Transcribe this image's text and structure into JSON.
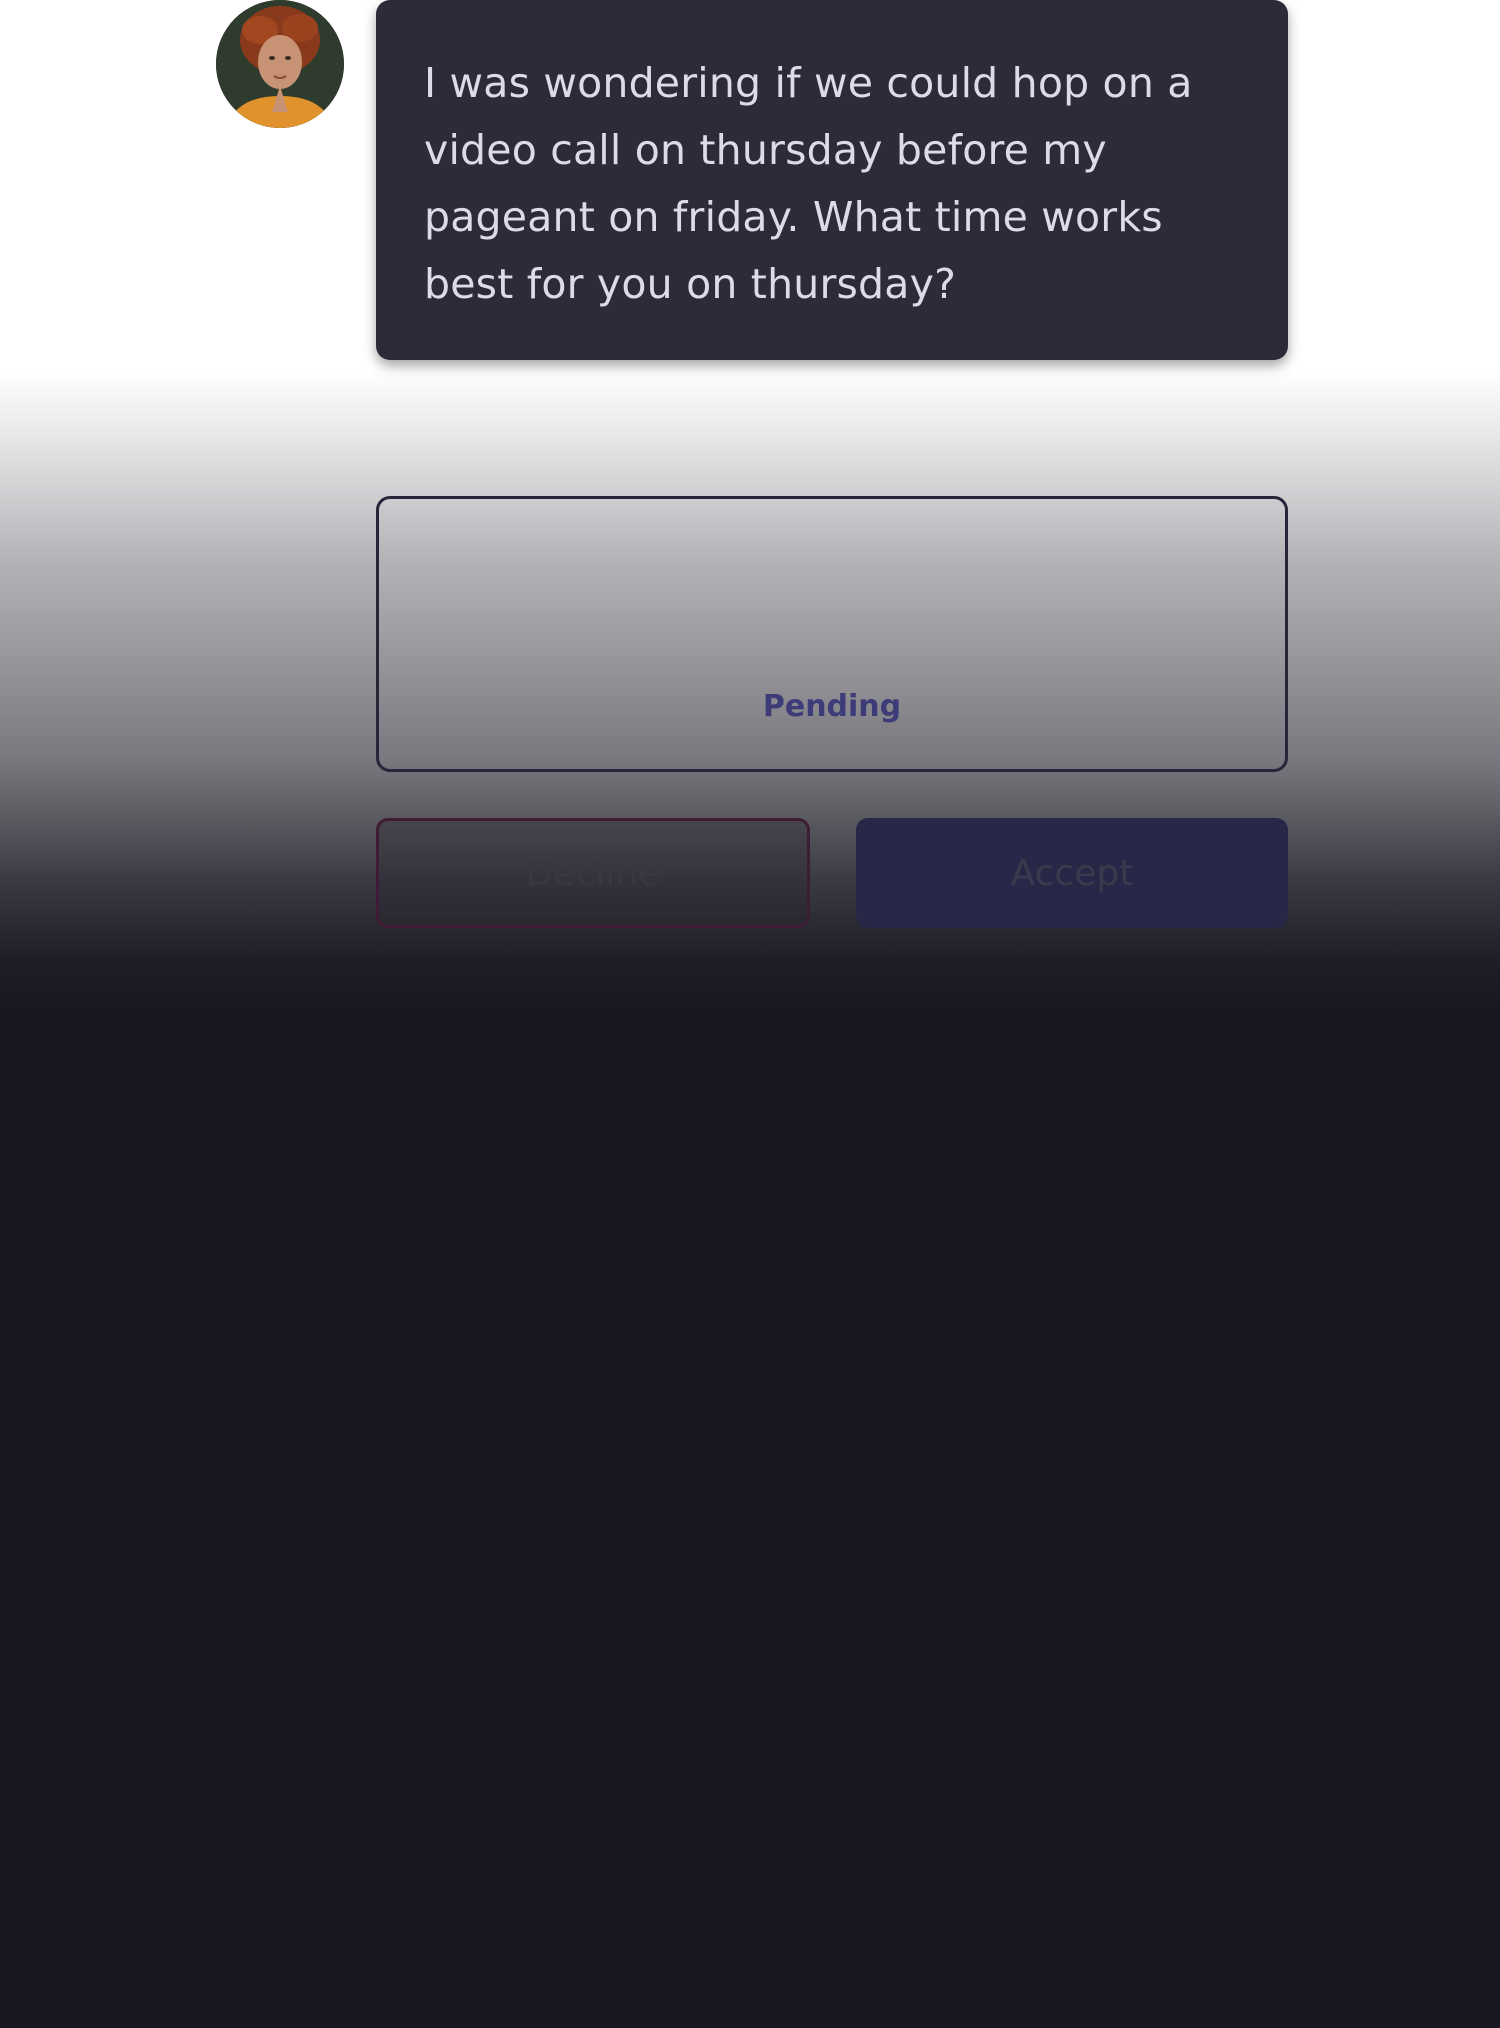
{
  "message": {
    "text": "I was wondering if we could hop on a video call on thursday before my pageant on friday. What time works best for you on thursday?",
    "avatar_icon": "user-avatar-photo"
  },
  "request": {
    "status": "Pending"
  },
  "actions": {
    "decline_label": "Decline",
    "accept_label": "Accept"
  },
  "colors": {
    "bubble_bg": "#2c2b3a",
    "page_bg": "#181820",
    "status_text": "#3d3c78",
    "accept_bg": "#282748",
    "decline_border": "#3e1c36"
  }
}
